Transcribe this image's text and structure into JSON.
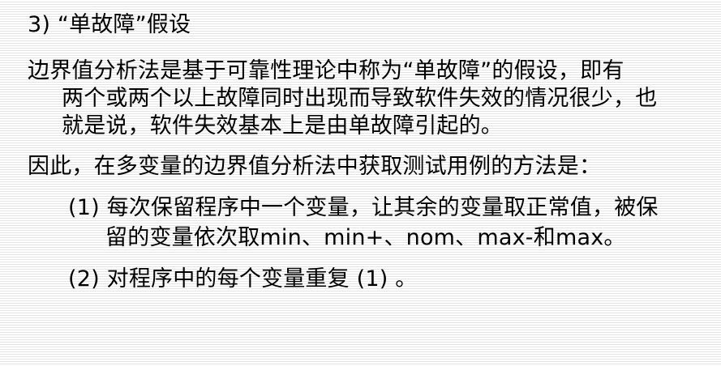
{
  "heading": "3) “单故障”假设",
  "paragraph1": {
    "line1": "边界值分析法是基于可靠性理论中称为“单故障”的假设，即有",
    "line2": "两个或两个以上故障同时出现而导致软件失效的情况很少，也",
    "line3": "就是说，软件失效基本上是由单故障引起的。"
  },
  "paragraph2": "因此，在多变量的边界值分析法中获取测试用例的方法是：",
  "item1": {
    "line1": "(1) 每次保留程序中一个变量，让其余的变量取正常值，被保",
    "line2": "留的变量依次取min、min+、nom、max-和max。"
  },
  "item2": "(2) 对程序中的每个变量重复 (1) 。"
}
